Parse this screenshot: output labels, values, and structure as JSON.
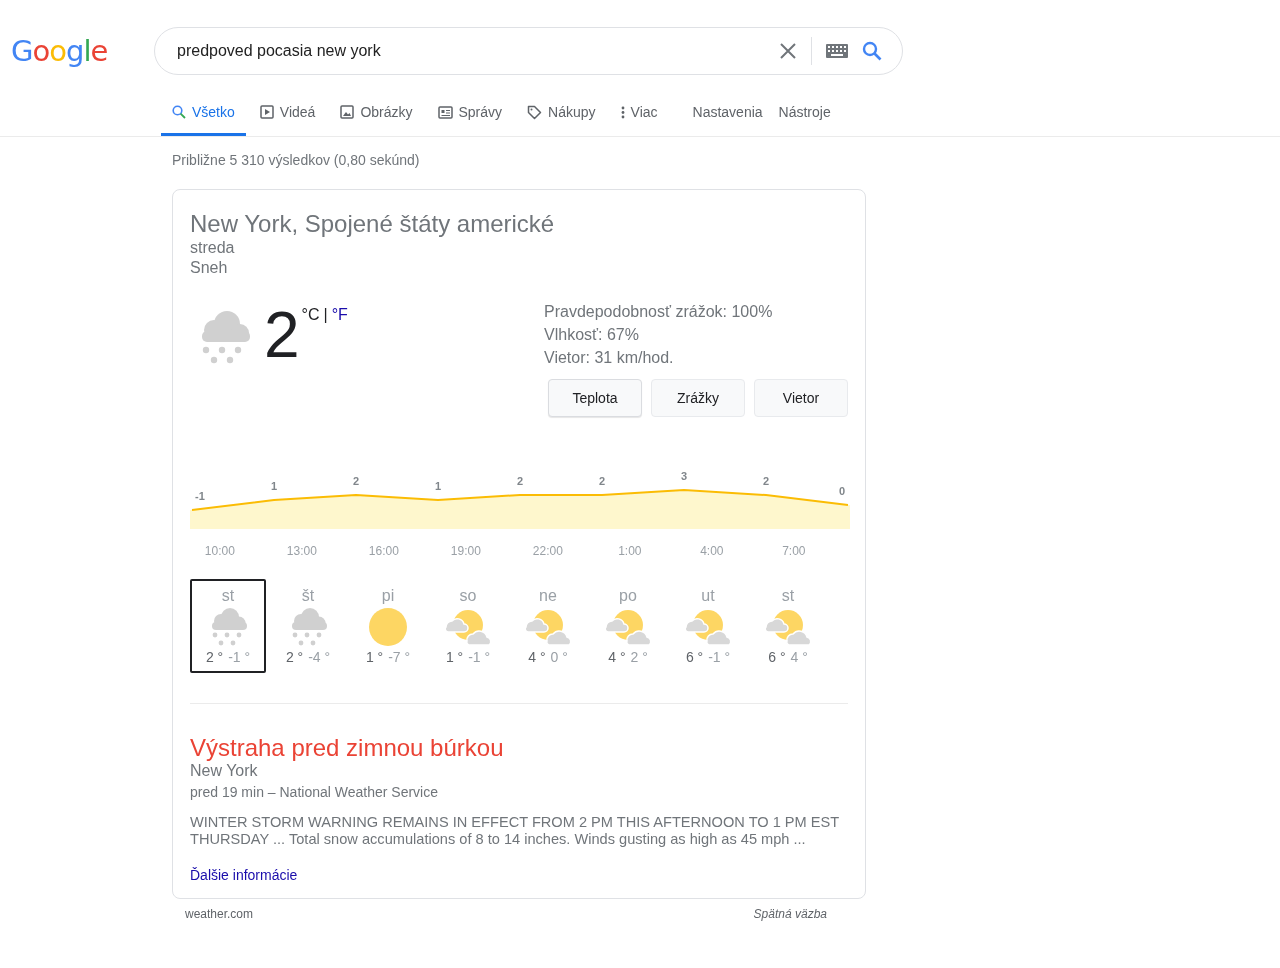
{
  "logo": "Google",
  "search": {
    "value": "predpoved pocasia new york"
  },
  "tabs": [
    {
      "label": "Všetko",
      "kind": "search",
      "selected": true
    },
    {
      "label": "Videá",
      "kind": "video",
      "selected": false
    },
    {
      "label": "Obrázky",
      "kind": "image",
      "selected": false
    },
    {
      "label": "Správy",
      "kind": "news",
      "selected": false
    },
    {
      "label": "Nákupy",
      "kind": "tag",
      "selected": false
    },
    {
      "label": "Viac",
      "kind": "more",
      "selected": false
    }
  ],
  "tools": [
    "Nastavenia",
    "Nástroje"
  ],
  "result_stats": "Približne 5 310 výsledkov (0,80 sekúnd)",
  "weather": {
    "location": "New York, Spojené štáty americké",
    "day": "streda",
    "condition": "Sneh",
    "kind": "snow",
    "temperature": "2",
    "unit_c": "°C",
    "unit_sep": "|",
    "unit_f": "°F",
    "details": [
      "Pravdepodobnosť zrážok: 100%",
      "Vlhkosť: 67%",
      "Vietor: 31 km/hod."
    ],
    "buttons": [
      {
        "label": "Teplota",
        "selected": true
      },
      {
        "label": "Zrážky",
        "selected": false
      },
      {
        "label": "Vietor",
        "selected": false
      }
    ],
    "hourly": {
      "readings": [
        "-1",
        "1",
        "2",
        "1",
        "2",
        "2",
        "3",
        "2",
        "0"
      ],
      "times": [
        "10:00",
        "13:00",
        "16:00",
        "19:00",
        "22:00",
        "1:00",
        "4:00",
        "7:00"
      ]
    },
    "days": [
      {
        "day": "st",
        "kind": "snow",
        "high": "2 °",
        "low": "-1 °",
        "selected": true
      },
      {
        "day": "št",
        "kind": "snow",
        "high": "2 °",
        "low": "-4 °",
        "selected": false
      },
      {
        "day": "pi",
        "kind": "sun",
        "high": "1 °",
        "low": "-7 °",
        "selected": false
      },
      {
        "day": "so",
        "kind": "partly",
        "high": "1 °",
        "low": "-1 °",
        "selected": false
      },
      {
        "day": "ne",
        "kind": "partly",
        "high": "4 °",
        "low": "0 °",
        "selected": false
      },
      {
        "day": "po",
        "kind": "partly",
        "high": "4 °",
        "low": "2 °",
        "selected": false
      },
      {
        "day": "ut",
        "kind": "partly",
        "high": "6 °",
        "low": "-1 °",
        "selected": false
      },
      {
        "day": "st",
        "kind": "partly",
        "high": "6 °",
        "low": "4 °",
        "selected": false
      }
    ]
  },
  "alert": {
    "title": "Výstraha pred zimnou búrkou",
    "place": "New York",
    "meta": "pred 19 min – National Weather Service",
    "text": "WINTER STORM WARNING REMAINS IN EFFECT FROM 2 PM THIS AFTERNOON TO 1 PM EST THURSDAY ... Total snow accumulations of 8 to 14 inches. Winds gusting as high as 45 mph ...",
    "link": "Ďalšie informácie"
  },
  "footer": {
    "source": "weather.com",
    "feedback": "Spätná väzba"
  }
}
